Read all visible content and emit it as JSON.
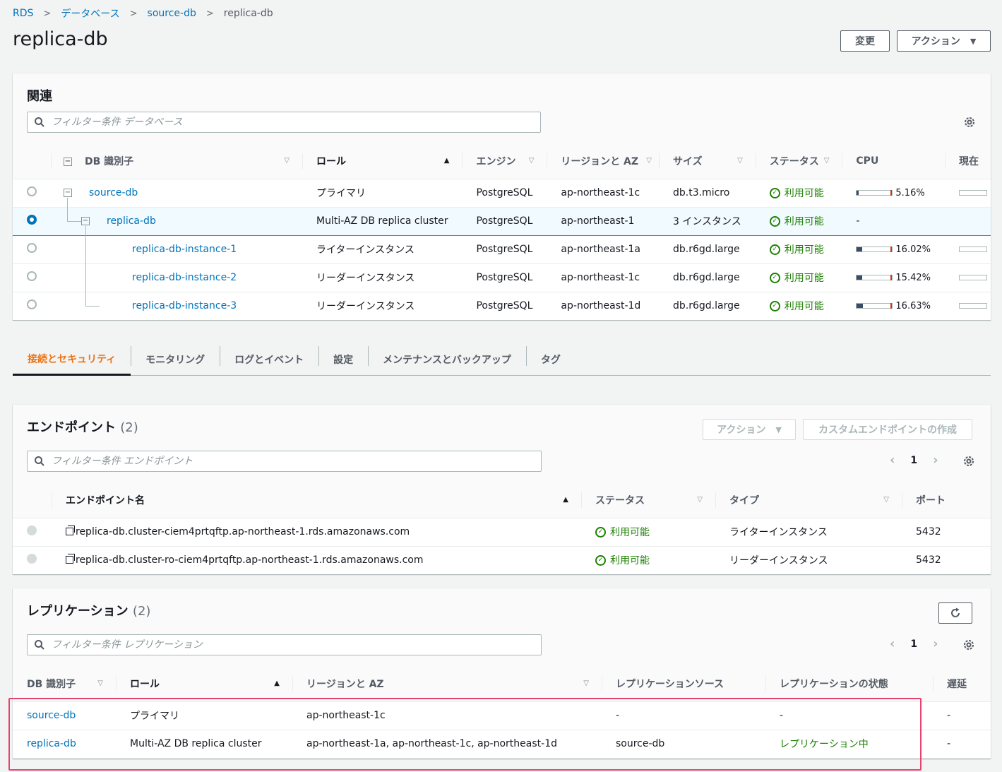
{
  "breadcrumb": {
    "rds": "RDS",
    "databases": "データベース",
    "source": "source-db",
    "current": "replica-db",
    "sep": ">"
  },
  "title": "replica-db",
  "header_buttons": {
    "modify": "変更",
    "actions": "アクション",
    "caret": "▼"
  },
  "related": {
    "title": "関連",
    "search_placeholder": "フィルター条件 データベース",
    "columns": {
      "id": "DB 識別子",
      "role": "ロール",
      "engine": "エンジン",
      "region": "リージョンと AZ",
      "size": "サイズ",
      "status": "ステータス",
      "cpu": "CPU",
      "current": "現在"
    },
    "rows": [
      {
        "id": "source-db",
        "role": "プライマリ",
        "engine": "PostgreSQL",
        "region": "ap-northeast-1c",
        "size": "db.t3.micro",
        "status": "利用可能",
        "cpu": "5.16%",
        "cpu_level": 0.05
      },
      {
        "id": "replica-db",
        "role": "Multi-AZ DB replica cluster",
        "engine": "PostgreSQL",
        "region": "ap-northeast-1",
        "size": "3 インスタンス",
        "status": "利用可能",
        "cpu": "-",
        "cpu_level": 0
      },
      {
        "id": "replica-db-instance-1",
        "role": "ライターインスタンス",
        "engine": "PostgreSQL",
        "region": "ap-northeast-1a",
        "size": "db.r6gd.large",
        "status": "利用可能",
        "cpu": "16.02%",
        "cpu_level": 0.16
      },
      {
        "id": "replica-db-instance-2",
        "role": "リーダーインスタンス",
        "engine": "PostgreSQL",
        "region": "ap-northeast-1c",
        "size": "db.r6gd.large",
        "status": "利用可能",
        "cpu": "15.42%",
        "cpu_level": 0.15
      },
      {
        "id": "replica-db-instance-3",
        "role": "リーダーインスタンス",
        "engine": "PostgreSQL",
        "region": "ap-northeast-1d",
        "size": "db.r6gd.large",
        "status": "利用可能",
        "cpu": "16.63%",
        "cpu_level": 0.17
      }
    ]
  },
  "tabs": [
    "接続とセキュリティ",
    "モニタリング",
    "ログとイベント",
    "設定",
    "メンテナンスとバックアップ",
    "タグ"
  ],
  "endpoints": {
    "title": "エンドポイント",
    "count": "(2)",
    "actions_button": "アクション",
    "create_button": "カスタムエンドポイントの作成",
    "search_placeholder": "フィルター条件 エンドポイント",
    "page": "1",
    "columns": {
      "name": "エンドポイント名",
      "status": "ステータス",
      "type": "タイプ",
      "port": "ポート"
    },
    "rows": [
      {
        "name": "replica-db.cluster-ciem4prtqftp.ap-northeast-1.rds.amazonaws.com",
        "status": "利用可能",
        "type": "ライターインスタンス",
        "port": "5432"
      },
      {
        "name": "replica-db.cluster-ro-ciem4prtqftp.ap-northeast-1.rds.amazonaws.com",
        "status": "利用可能",
        "type": "リーダーインスタンス",
        "port": "5432"
      }
    ]
  },
  "replication": {
    "title": "レプリケーション",
    "count": "(2)",
    "search_placeholder": "フィルター条件 レプリケーション",
    "page": "1",
    "columns": {
      "id": "DB 識別子",
      "role": "ロール",
      "region": "リージョンと AZ",
      "source": "レプリケーションソース",
      "state": "レプリケーションの状態",
      "lag": "遅延"
    },
    "rows": [
      {
        "id": "source-db",
        "role": "プライマリ",
        "region": "ap-northeast-1c",
        "source": "-",
        "state": "-",
        "lag": "-"
      },
      {
        "id": "replica-db",
        "role": "Multi-AZ DB replica cluster",
        "region": "ap-northeast-1a, ap-northeast-1c, ap-northeast-1d",
        "source": "source-db",
        "state": "レプリケーション中",
        "lag": "-"
      }
    ]
  },
  "icons": {
    "search": "search-icon",
    "gear": "gear-icon",
    "refresh": "refresh-icon",
    "check": "check-circle-icon",
    "copy": "copy-icon"
  },
  "colors": {
    "link": "#0073bb",
    "ok": "#1d8102",
    "active_tab": "#ec7211",
    "highlight": "#e8436e"
  }
}
